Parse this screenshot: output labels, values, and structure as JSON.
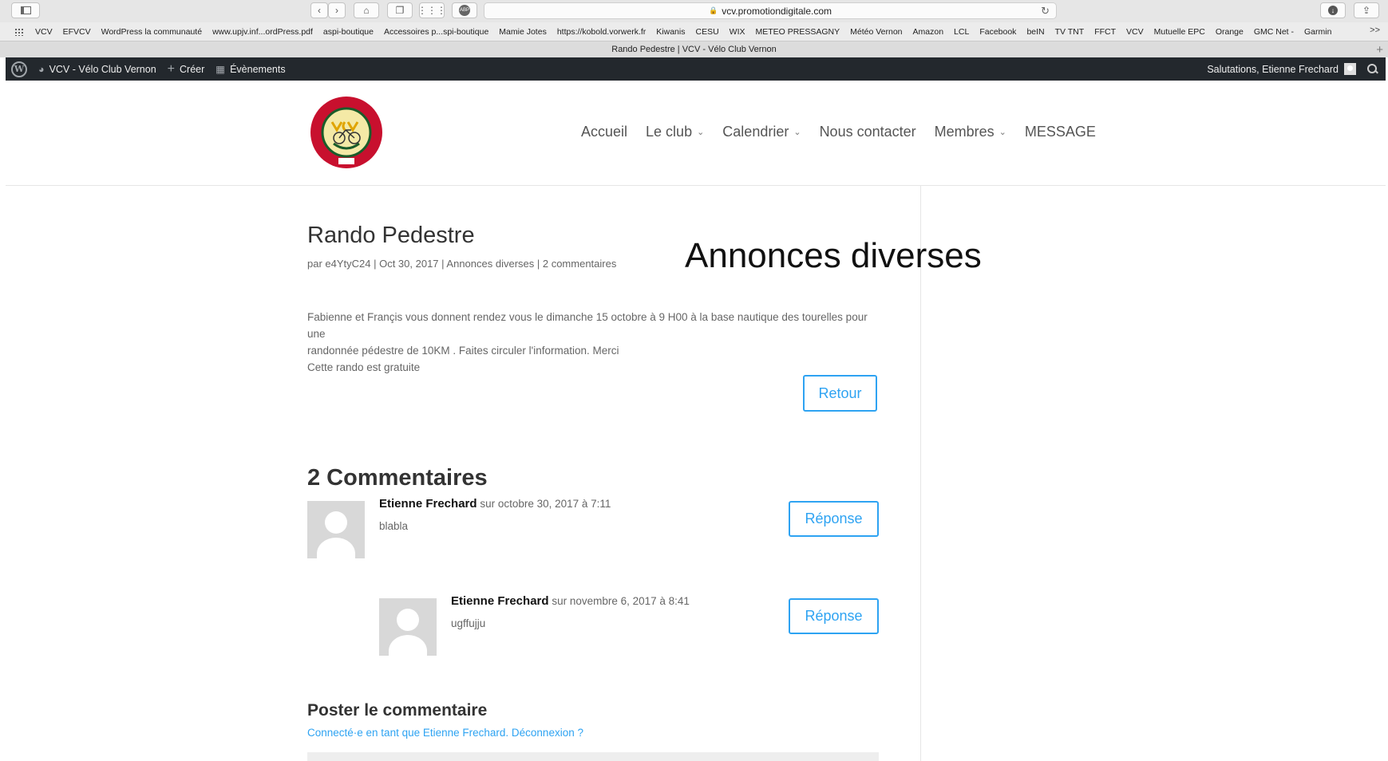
{
  "browser": {
    "address": "vcv.promotiondigitale.com",
    "tab_title": "Rando Pedestre | VCV - Vélo Club Vernon",
    "bookmarks": [
      "VCV",
      "EFVCV",
      "WordPress  la communauté",
      "www.upjv.inf...ordPress.pdf",
      "aspi-boutique",
      "Accessoires p...spi-boutique",
      "Mamie Jotes",
      "https://kobold.vorwerk.fr",
      "Kiwanis",
      "CESU",
      "WIX",
      "METEO PRESSAGNY",
      "Météo Vernon",
      "Amazon",
      "LCL",
      "Facebook",
      "beIN",
      "TV TNT",
      "FFCT",
      "VCV",
      "Mutuelle EPC",
      "Orange",
      "GMC Net -",
      "Garmin"
    ],
    "more": ">>"
  },
  "adminbar": {
    "site_name": "VCV - Vélo Club Vernon",
    "create": "Créer",
    "events": "Évènements",
    "greeting": "Salutations, Etienne Frechard"
  },
  "nav": {
    "items": [
      "Accueil",
      "Le club",
      "Calendrier",
      "Nous contacter",
      "Membres",
      "MESSAGE"
    ]
  },
  "post": {
    "title": "Rando Pedestre",
    "meta": "par e4YtyC24 | Oct 30, 2017 | Annonces diverses | 2 commentaires",
    "category_overlay": "Annonces diverses",
    "body_line1": "Fabienne et Françis vous donnent rendez vous le dimanche 15 octobre à 9 H00 à la base nautique des tourelles pour une",
    "body_line2": "randonnée pédestre de 10KM . Faites circuler l'information. Merci",
    "body_line3": "Cette rando est gratuite",
    "back_button": "Retour"
  },
  "comments": {
    "title": "2 Commentaires",
    "list": [
      {
        "author": "Etienne Frechard",
        "date": "sur octobre 30, 2017 à 7:11",
        "text": "blabla",
        "reply": "Réponse"
      },
      {
        "author": "Etienne Frechard",
        "date": "sur novembre 6, 2017 à 8:41",
        "text": "ugffujju",
        "reply": "Réponse"
      }
    ]
  },
  "respond": {
    "title": "Poster le commentaire",
    "logged_in": "Connecté·e en tant que Etienne Frechard. Déconnexion ?"
  },
  "colors": {
    "accent": "#2ea3f2",
    "adminbar": "#23282d"
  }
}
